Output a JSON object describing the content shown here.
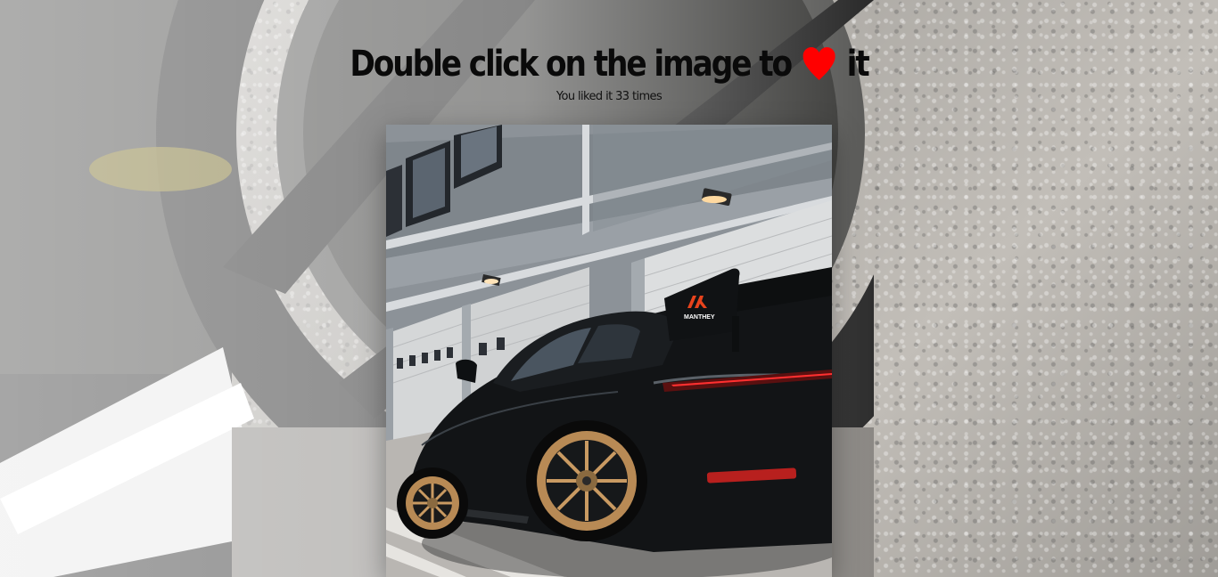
{
  "header": {
    "title_before": "Double click on the image to",
    "title_after": "it",
    "heart_icon": "heart-icon",
    "heart_color": "#ff0000"
  },
  "likes": {
    "text": "You liked it 33 times",
    "count": 33
  },
  "photo": {
    "subject": "black sports car in pit lane",
    "wing_logo": "MANTHEY",
    "wing_accent": "#e8431c"
  }
}
